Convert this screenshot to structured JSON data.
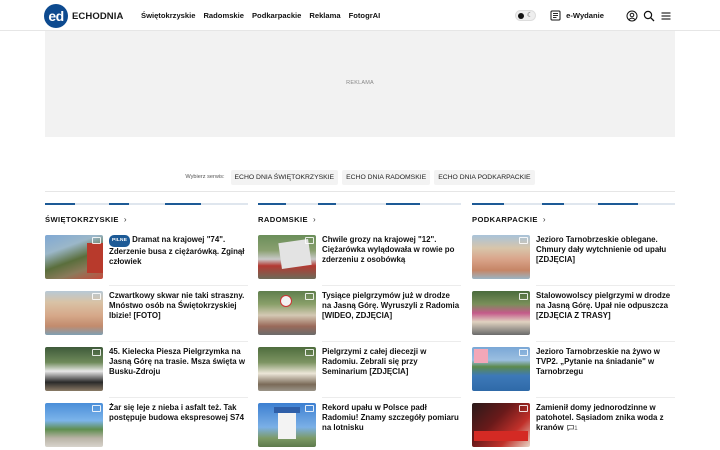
{
  "header": {
    "logo_mark": "ed",
    "logo_text": "ECHODNIA",
    "nav": [
      "Świętokrzyskie",
      "Radomskie",
      "Podkarpackie",
      "Reklama",
      "FotogrAI"
    ],
    "ewydanie": "e-Wydanie",
    "icons": [
      "theme-toggle-icon",
      "newspaper-icon",
      "user-icon",
      "search-icon",
      "menu-icon"
    ]
  },
  "ad": {
    "label": "REKLAMA"
  },
  "services": {
    "label": "Wybierz serwis:",
    "options": [
      "ECHO DNIA ŚWIĘTOKRZYSKIE",
      "ECHO DNIA RADOMSKIE",
      "ECHO DNIA PODKARPACKIE"
    ]
  },
  "columns": [
    {
      "title": "ŚWIĘTOKRZYSKIE",
      "articles": [
        {
          "badge": "PILNE",
          "title": "Dramat na krajowej \"74\". Zderzenie busa z ciężarówką. Zginął człowiek"
        },
        {
          "title": "Czwartkowy skwar nie taki straszny. Mnóstwo osób na Świętokrzyskiej Ibizie! [FOTO]"
        },
        {
          "title": "45. Kielecka Piesza Pielgrzymka na Jasną Górę na trasie. Msza święta w Busku-Zdroju"
        },
        {
          "title": "Żar się leje z nieba i asfalt też. Tak postępuje budowa ekspresowej S74"
        }
      ]
    },
    {
      "title": "RADOMSKIE",
      "articles": [
        {
          "title": "Chwile grozy na krajowej \"12\". Ciężarówka wylądowała w rowie po zderzeniu z osobówką"
        },
        {
          "title": "Tysiące pielgrzymów już w drodze na Jasną Górę. Wyruszyli z Radomia [WIDEO, ZDJĘCIA]"
        },
        {
          "title": "Pielgrzymi z całej diecezji w Radomiu. Zebrali się przy Seminarium [ZDJĘCIA]"
        },
        {
          "title": "Rekord upału w Polsce padł Radomiu! Znamy szczegóły pomiaru na lotnisku"
        }
      ]
    },
    {
      "title": "PODKARPACKIE",
      "articles": [
        {
          "title": "Jezioro Tarnobrzeskie oblegane. Chmury dały wytchnienie od upału [ZDJĘCIA]"
        },
        {
          "title": "Stalowowolscy pielgrzymi w drodze na Jasną Górę. Upał nie odpuszcza [ZDJĘCIA Z TRASY]"
        },
        {
          "title": "Jezioro Tarnobrzeskie na żywo w TVP2. „Pytanie na śniadanie\" w Tarnobrzegu"
        },
        {
          "title": "Zamienił domy jednorodzinne w patohotel. Sąsiadom znika woda z kranów",
          "comments": "1"
        }
      ]
    }
  ]
}
